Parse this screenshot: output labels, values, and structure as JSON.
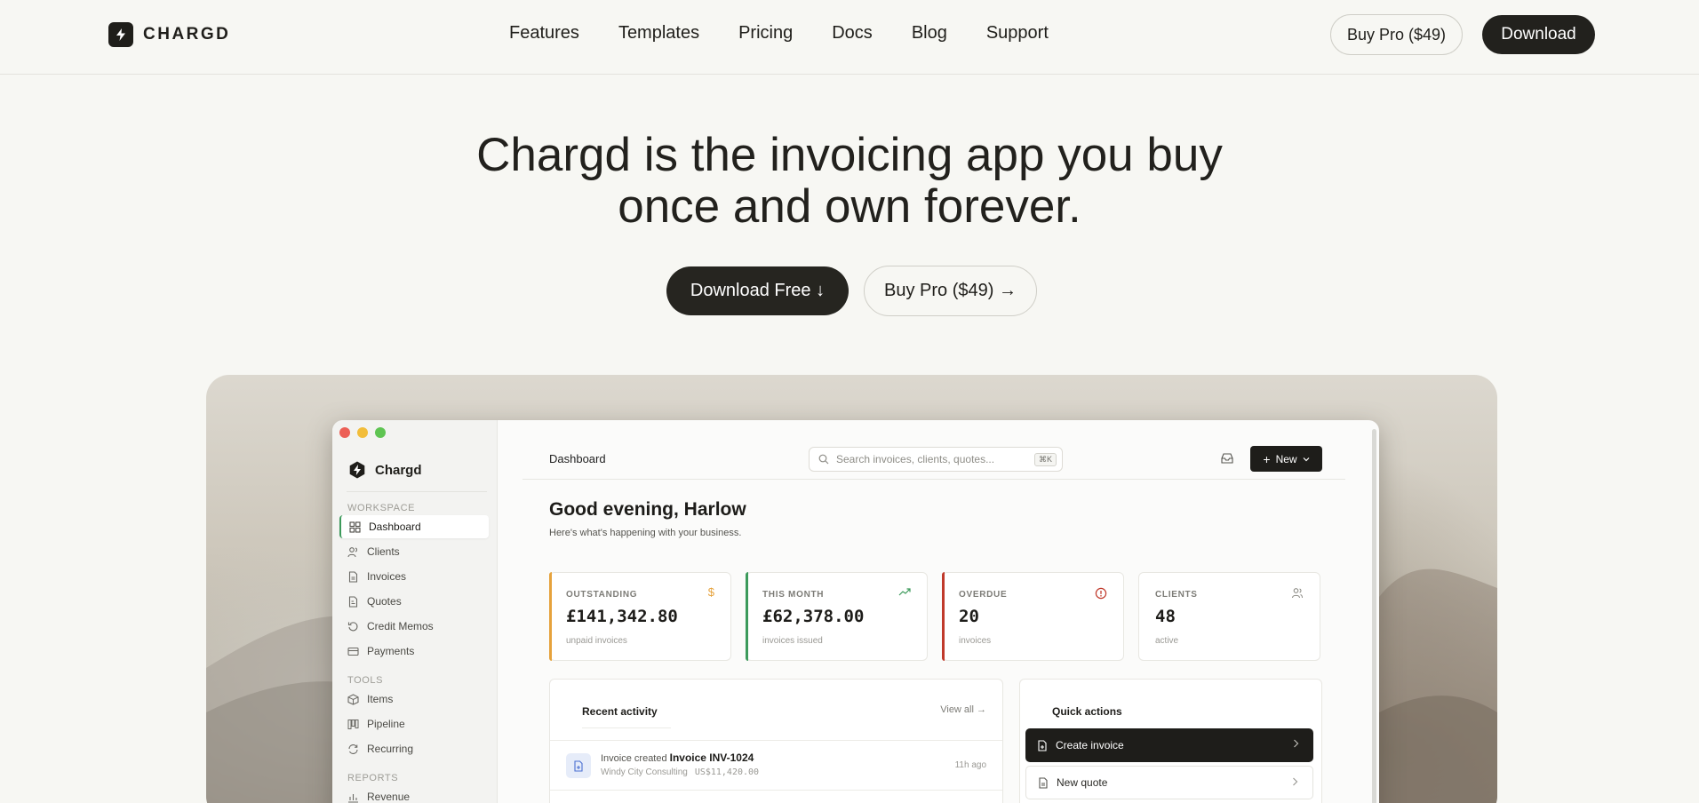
{
  "nav": {
    "brand": "CHARGD",
    "links": [
      "Features",
      "Templates",
      "Pricing",
      "Docs",
      "Blog",
      "Support"
    ],
    "buy_pro": "Buy Pro ($49)",
    "download": "Download"
  },
  "hero": {
    "title_line1": "Chargd is the invoicing app you buy",
    "title_line2": "once and own forever.",
    "cta_primary": "Download Free ↓",
    "cta_secondary": "Buy Pro ($49) →"
  },
  "app": {
    "brand": "Chargd",
    "sidebar": {
      "section_workspace": "WORKSPACE",
      "workspace_items": [
        "Dashboard",
        "Clients",
        "Invoices",
        "Quotes",
        "Credit Memos",
        "Payments"
      ],
      "section_tools": "TOOLS",
      "tools_items": [
        "Items",
        "Pipeline",
        "Recurring"
      ],
      "section_reports": "REPORTS",
      "reports_items": [
        "Revenue"
      ]
    },
    "header": {
      "title": "Dashboard",
      "search_placeholder": "Search invoices, clients, quotes...",
      "shortcut": "⌘K",
      "new_label": "New"
    },
    "greeting": "Good evening, Harlow",
    "greeting_sub": "Here's what's happening with your business.",
    "cards": [
      {
        "label": "OUTSTANDING",
        "value": "£141,342.80",
        "sub": "unpaid invoices",
        "accent": "#e6a23c"
      },
      {
        "label": "THIS MONTH",
        "value": "£62,378.00",
        "sub": "invoices issued",
        "accent": "#3c9a5b"
      },
      {
        "label": "OVERDUE",
        "value": "20",
        "sub": "invoices",
        "accent": "#c0392b"
      },
      {
        "label": "CLIENTS",
        "value": "48",
        "sub": "active",
        "accent": "#e8e7e2"
      }
    ],
    "recent": {
      "title": "Recent activity",
      "view_all": "View all →",
      "items": [
        {
          "action": "Invoice created",
          "ref": "Invoice INV-1024",
          "client": "Windy City Consulting",
          "amount": "US$11,420.00",
          "time": "11h ago"
        }
      ]
    },
    "quick": {
      "title": "Quick actions",
      "items": [
        "Create invoice",
        "New quote"
      ]
    }
  }
}
